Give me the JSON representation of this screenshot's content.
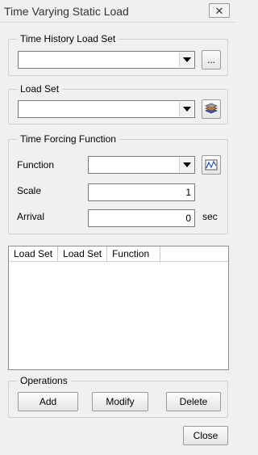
{
  "window": {
    "title": "Time Varying Static Load",
    "close_glyph": "✕"
  },
  "time_history": {
    "legend": "Time History Load Set",
    "value": "",
    "browse_label": "..."
  },
  "load_set": {
    "legend": "Load Set",
    "value": "",
    "icon": "layers-icon"
  },
  "forcing": {
    "legend": "Time Forcing Function",
    "function_label": "Function",
    "function_value": "",
    "function_icon": "graph-icon",
    "scale_label": "Scale",
    "scale_value": "1",
    "arrival_label": "Arrival",
    "arrival_value": "0",
    "arrival_unit": "sec"
  },
  "table": {
    "columns": [
      "Load Set",
      "Load Set",
      "Function"
    ],
    "rows": []
  },
  "operations": {
    "legend": "Operations",
    "add_label": "Add",
    "modify_label": "Modify",
    "delete_label": "Delete"
  },
  "footer": {
    "close_label": "Close"
  }
}
